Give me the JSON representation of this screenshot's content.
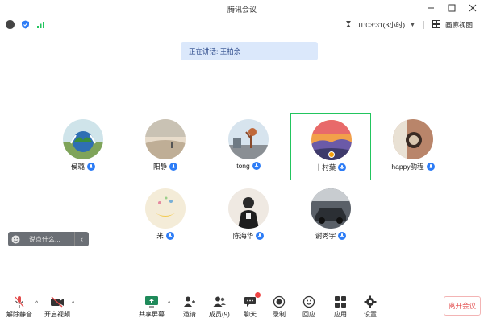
{
  "window": {
    "title": "腾讯会议"
  },
  "infobar": {
    "duration": "01:03:31(3小时)",
    "view_label": "画廊视图"
  },
  "speaking": {
    "text": "正在讲话: 王柏余"
  },
  "participants": [
    {
      "name": "侯璐",
      "muted": false
    },
    {
      "name": "阳静",
      "muted": false
    },
    {
      "name": "tong",
      "muted": false
    },
    {
      "name": "十村葉",
      "muted": false,
      "host": true,
      "active": true
    },
    {
      "name": "happy韵程",
      "muted": false
    },
    {
      "name": "米",
      "muted": false
    },
    {
      "name": "陈海华",
      "muted": false
    },
    {
      "name": "谢秀宇",
      "muted": false
    }
  ],
  "chat": {
    "placeholder": "说点什么..."
  },
  "toolbar": {
    "mute_label": "解除静音",
    "video_label": "开启视频",
    "share_label": "共享屏幕",
    "invite_label": "邀请",
    "members_label": "成员(9)",
    "chat_label": "聊天",
    "record_label": "录制",
    "reaction_label": "回应",
    "apps_label": "应用",
    "settings_label": "设置",
    "end_label": "离开会议"
  },
  "colors": {
    "accent": "#2d7cf6",
    "active_border": "#22c55e",
    "end": "#e24a4a"
  }
}
